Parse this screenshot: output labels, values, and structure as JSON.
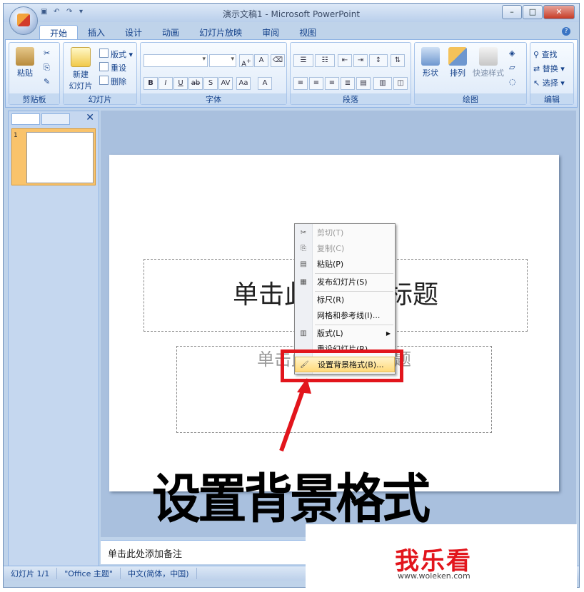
{
  "window": {
    "title": "演示文稿1 - Microsoft PowerPoint"
  },
  "tabs": [
    "开始",
    "插入",
    "设计",
    "动画",
    "幻灯片放映",
    "审阅",
    "视图"
  ],
  "ribbon": {
    "clipboard": {
      "label": "剪贴板",
      "paste": "粘贴"
    },
    "slides": {
      "label": "幻灯片",
      "new_slide_line1": "新建",
      "new_slide_line2": "幻灯片",
      "layout": "版式",
      "reset": "重设",
      "delete": "删除"
    },
    "font": {
      "label": "字体"
    },
    "paragraph": {
      "label": "段落"
    },
    "drawing": {
      "label": "绘图",
      "shapes": "形状",
      "arrange": "排列",
      "quick_styles": "快速样式"
    },
    "editing": {
      "label": "编辑",
      "find": "查找",
      "replace": "替换",
      "select": "选择"
    }
  },
  "slide": {
    "title_placeholder": "单击此处添加标题",
    "subtitle_placeholder": "单击此处添加副标题",
    "thumbnail_number": "1"
  },
  "notes": {
    "placeholder": "单击此处添加备注"
  },
  "status": {
    "slide": "幻灯片 1/1",
    "theme": "\"Office 主题\"",
    "language": "中文(简体，中国)"
  },
  "context_menu": [
    {
      "label": "剪切(T)",
      "icon": "scissors-icon",
      "disabled": true
    },
    {
      "label": "复制(C)",
      "icon": "copy-icon",
      "disabled": true
    },
    {
      "label": "粘贴(P)",
      "icon": "paste-icon",
      "disabled": false
    },
    {
      "label": "发布幻灯片(S)",
      "icon": "publish-icon",
      "disabled": false
    },
    {
      "label": "标尺(R)",
      "icon": "",
      "disabled": false
    },
    {
      "label": "网格和参考线(I)...",
      "icon": "",
      "disabled": false
    },
    {
      "label": "版式(L)",
      "icon": "layout-icon",
      "disabled": false,
      "submenu": true
    },
    {
      "label": "重设幻灯片(R)",
      "icon": "",
      "disabled": false
    },
    {
      "label": "设置背景格式(B)...",
      "icon": "paint-icon",
      "disabled": false,
      "highlight": true
    }
  ],
  "annotation": {
    "caption": "设置背景格式",
    "highlight_color": "#e2151c"
  },
  "watermark": {
    "text": "我乐看",
    "url": "www.woleken.com"
  }
}
